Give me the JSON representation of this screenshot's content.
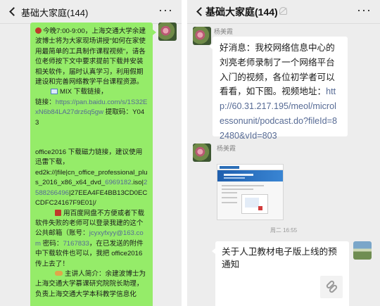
{
  "left_chat": {
    "title": "基础大家庭(144)",
    "more": "···",
    "message": {
      "para1": "今晚7:00-9:00，上海交通大学余建波博士将为大家现场讲授\"如何在家使用最简单的工具制作课程视频\"，请各位老师按下文中要求提前下载并安装相关软件，届时认真学习，利用假期建设和完善网络教学平台课程资源。",
      "mix_label": "MIX 下载链接，",
      "link_label": "链接：",
      "link_url": "https://pan.baidu.com/s/1S32ExN6b84LA27drz6q5gw",
      "code_text": " 提取码：Y043",
      "office_intro": "office2016 下载磁力链接，建议使用迅雷下载，",
      "ed2k_prefix": "ed2k://|file|cn_office_professional_plus_2016_x86_x64_dvd_",
      "ed2k_num1": "6969182",
      "ed2k_mid": ".iso|",
      "ed2k_num2": "2588266496",
      "ed2k_tail": "|27EEA4FE4BB13CD0ECCDFC24167F9E01|/",
      "baidu_note_1": "用百度网盘不方便或者下载软件失败的老师可以登录我建的这个公共邮箱（账号：",
      "email": "jcyxyfxyy@163.com",
      "baidu_note_2": " 密码：",
      "password": "7167833",
      "baidu_note_3": "，在已发送的附件中下载软件也可以，我把 office2016 传上去了！",
      "speaker": "主讲人简介：余建波博士为上海交通大学慕课研究院院长助理，负责上海交通大学本科教学信息化"
    }
  },
  "right_chat": {
    "title": "基础大家庭(144)",
    "more": "···",
    "sender1": "杨美霞",
    "text_message": "好消息：我校网络信息中心的刘亮老师录制了一个网络平台入门的视频，各位初学者可以看看，如下图。视频地址：",
    "text_link": "http://60.31.217.195/meol/microlessonunit/podcast.do?fileId=82480&vId=803",
    "sender2": "杨美霞",
    "timestamp": "周二 16:55",
    "card_title": "关于人卫教材电子版上线的预通知"
  },
  "colors": {
    "chat_bg": "#ededed",
    "my_bubble": "#95ec69",
    "other_bubble": "#ffffff",
    "link": "#576b95"
  }
}
